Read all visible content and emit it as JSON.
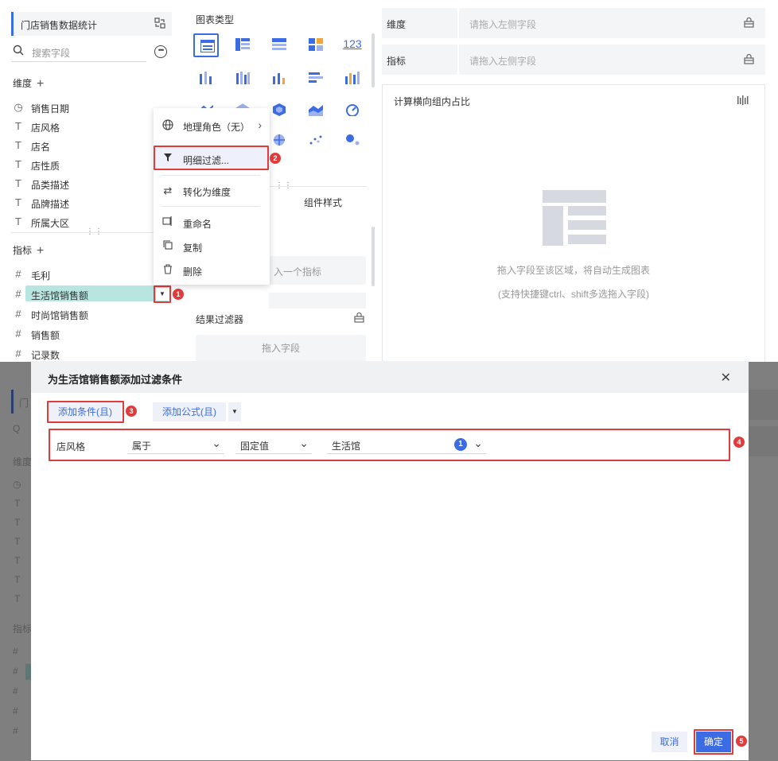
{
  "left_panel": {
    "dataset_name": "门店销售数据统计",
    "search_placeholder": "搜索字段",
    "dimensions_title": "维度",
    "dimensions": [
      "销售日期",
      "店风格",
      "店名",
      "店性质",
      "品类描述",
      "品牌描述",
      "所属大区"
    ],
    "measures_title": "指标",
    "measures": [
      "毛利",
      "生活馆销售额",
      "时尚馆销售额",
      "销售额",
      "记录数"
    ]
  },
  "context_menu": {
    "items": [
      "地理角色（无）",
      "明细过滤...",
      "转化为维度",
      "重命名",
      "复制",
      "删除"
    ]
  },
  "middle_panel": {
    "chart_type_title": "图表类型",
    "tab_component_style": "组件样式",
    "measure_zone_placeholder": "入一个指标",
    "result_filter_title": "结果过滤器",
    "result_filter_placeholder": "拖入字段"
  },
  "right_panel": {
    "dimension_label": "维度",
    "measure_label": "指标",
    "drop_placeholder": "请拖入左侧字段",
    "canvas_title": "计算横向组内占比",
    "empty_line1": "拖入字段至该区域，将自动生成图表",
    "empty_line2": "(支持快捷键ctrl、shift多选拖入字段)"
  },
  "dialog": {
    "title": "为生活馆销售额添加过滤条件",
    "add_condition": "添加条件(且)",
    "add_formula": "添加公式(且)",
    "condition": {
      "field": "店风格",
      "operator": "属于",
      "value_type": "固定值",
      "value": "生活馆",
      "selected_count": "1"
    },
    "cancel": "取消",
    "confirm": "确定"
  },
  "annotations": [
    "1",
    "2",
    "3",
    "4",
    "5"
  ],
  "colors": {
    "accent": "#3c6ce4",
    "highlight_field": "#b9e5e0",
    "annotation_red": "#e23b3b",
    "overlay": "#7f7f7f"
  }
}
